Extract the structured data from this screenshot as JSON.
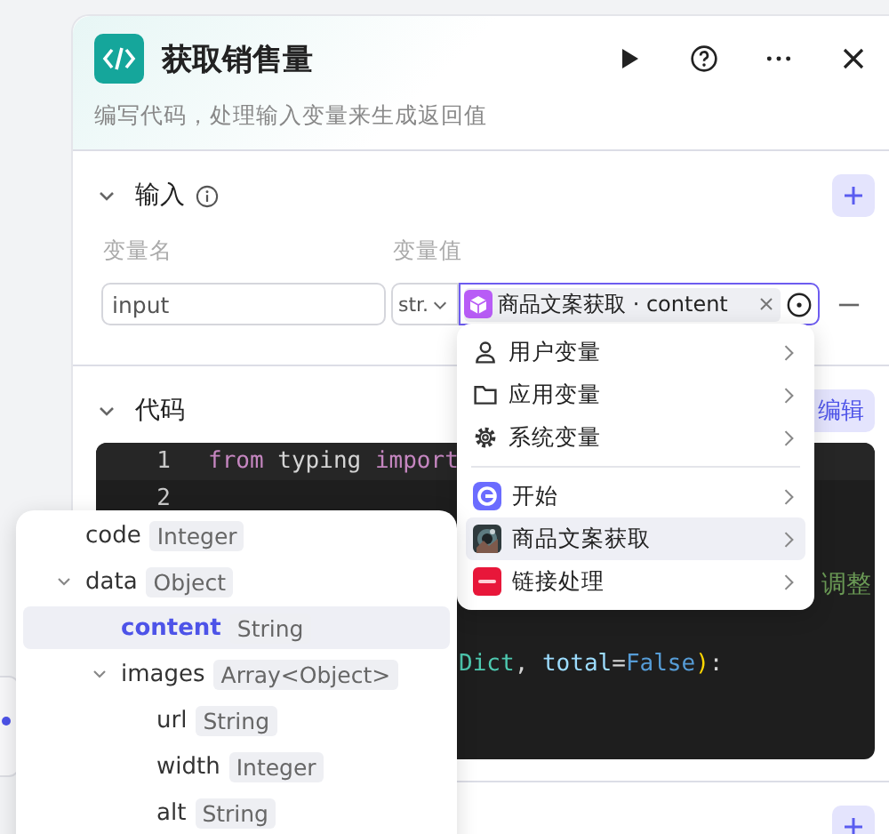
{
  "header": {
    "title": "获取销售量",
    "description": "编写代码，处理输入变量来生成返回值"
  },
  "input_section": {
    "title": "输入",
    "expanded": true,
    "columns": [
      "变量名",
      "变量值"
    ],
    "rows": [
      {
        "name": "input",
        "type": "str.",
        "reference": "商品文案获取 · content"
      }
    ]
  },
  "code_section": {
    "title": "代码",
    "expanded": true,
    "edit_button": "编辑",
    "lines": [
      {
        "kind": "numbered",
        "number": "1",
        "tokens": [
          {
            "text": "from",
            "kind": "keyword"
          },
          {
            "text": " typing ",
            "kind": "plain"
          },
          {
            "text": "import",
            "kind": "keyword"
          }
        ]
      },
      {
        "kind": "numbered",
        "number": "2"
      },
      {
        "kind": "end",
        "tokens": [
          {
            "text": "调整",
            "kind": "comment"
          }
        ]
      },
      {
        "kind": "tail",
        "tokens": [
          {
            "text": "Dict",
            "kind": "type"
          },
          {
            "text": ", ",
            "kind": "plain"
          },
          {
            "text": "total",
            "kind": "param"
          },
          {
            "text": "=",
            "kind": "plain"
          },
          {
            "text": "False",
            "kind": "constant"
          },
          {
            "text": ")",
            "kind": "bracket"
          },
          {
            "text": ":",
            "kind": "plain"
          }
        ]
      }
    ]
  },
  "variable_menu": {
    "groups": [
      [
        {
          "label": "用户变量",
          "kind": "user",
          "selected": false
        },
        {
          "label": "应用变量",
          "kind": "app",
          "selected": false
        },
        {
          "label": "系统变量",
          "kind": "system",
          "selected": false
        }
      ],
      [
        {
          "label": "开始",
          "kind": "start",
          "selected": false
        },
        {
          "label": "商品文案获取",
          "selected": true
        },
        {
          "label": "链接处理",
          "kind": "red",
          "selected": false
        }
      ]
    ]
  },
  "output_tree": {
    "items": [
      {
        "name": "code",
        "type": "Integer",
        "selected": false
      },
      {
        "name": "data",
        "type": "Object",
        "selected": false,
        "expanded": true,
        "children": [
          {
            "name": "content",
            "type": "String",
            "selected": true
          },
          {
            "name": "images",
            "type": "Array<Object>",
            "selected": false,
            "expanded": true,
            "children": [
              {
                "name": "url",
                "type": "String",
                "selected": false
              },
              {
                "name": "width",
                "type": "Integer",
                "selected": false
              },
              {
                "name": "alt",
                "type": "String",
                "selected": false
              }
            ]
          }
        ]
      }
    ]
  }
}
